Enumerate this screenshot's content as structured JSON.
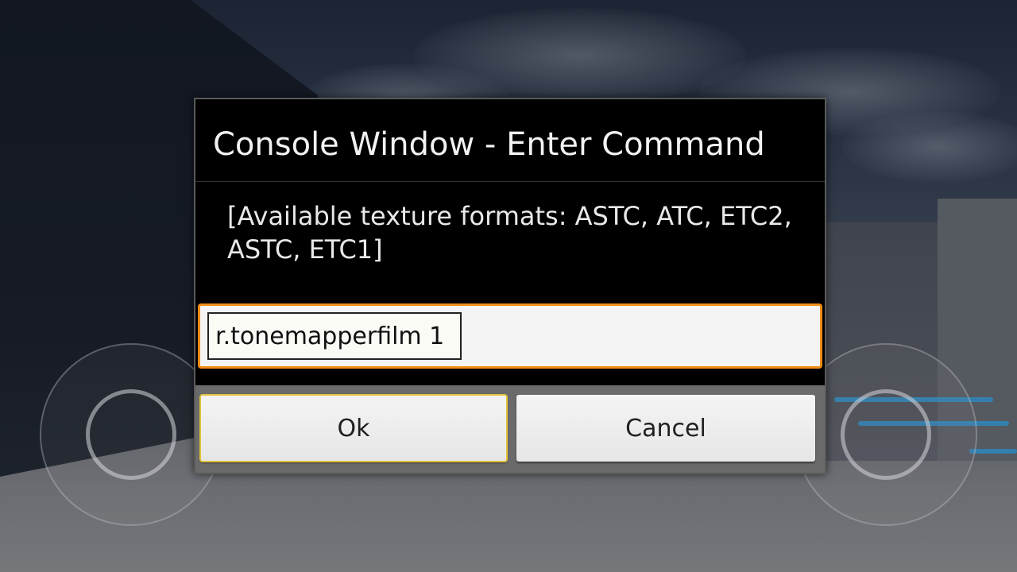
{
  "dialog": {
    "title": "Console Window - Enter Command",
    "message": "[Available texture formats: ASTC, ATC, ETC2, ASTC, ETC1]",
    "command_value": "r.tonemapperfilm 1",
    "ok_label": "Ok",
    "cancel_label": "Cancel"
  },
  "colors": {
    "dialog_background": "#000000",
    "focus_accent": "#f08c17",
    "button_bar": "#6a6a6a"
  },
  "icons": {
    "left_joystick": "virtual-joystick",
    "right_joystick": "virtual-joystick"
  }
}
